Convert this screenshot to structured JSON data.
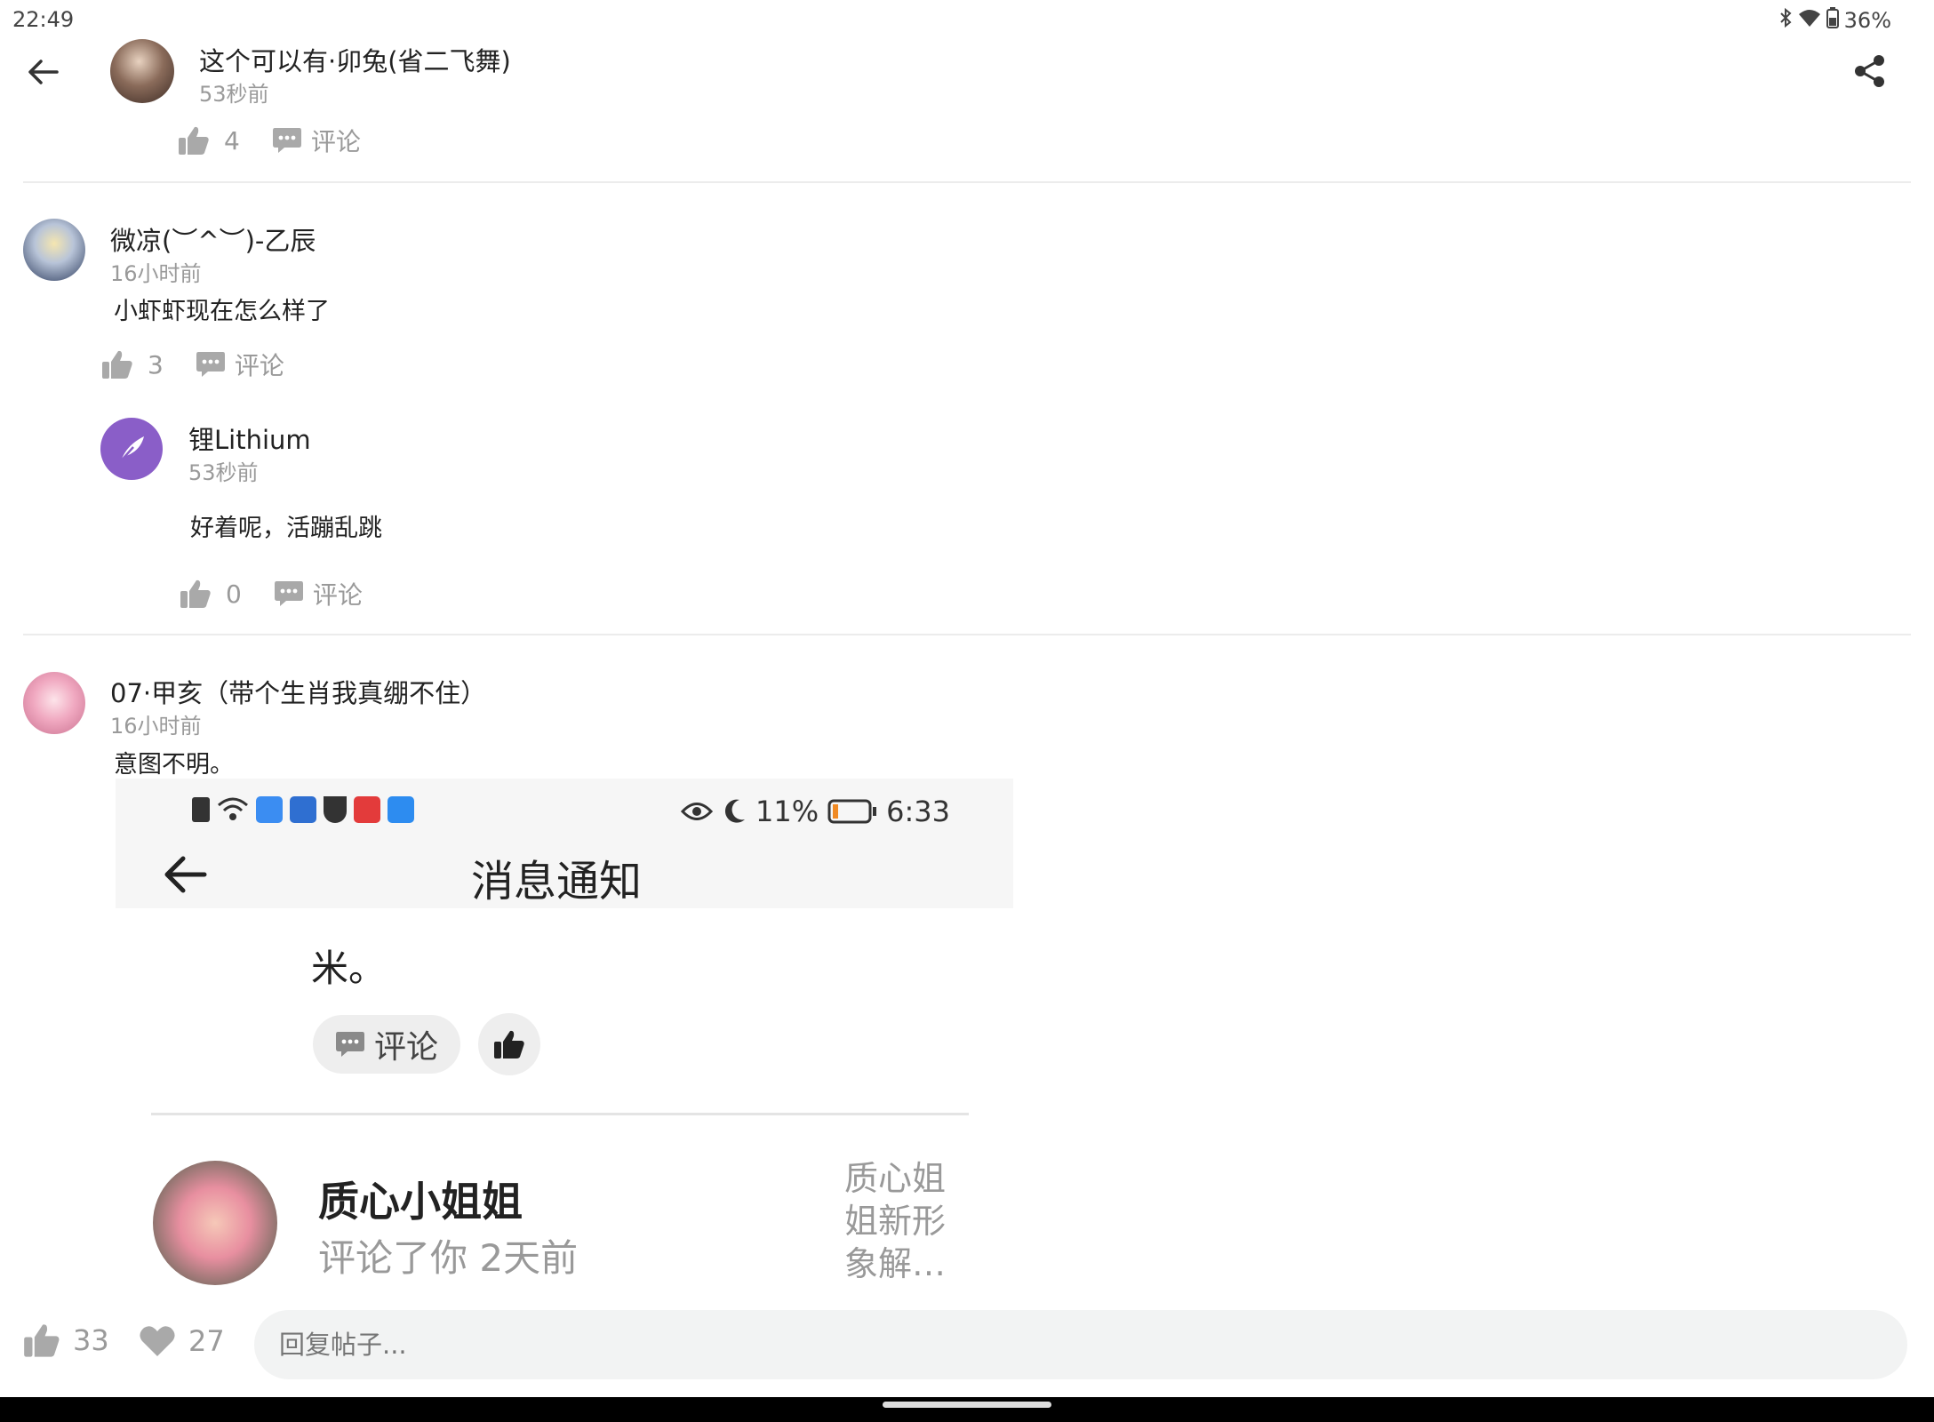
{
  "status": {
    "time": "22:49",
    "battery": "36%"
  },
  "header": {
    "author": "这个可以有·卯兔(省二飞舞)",
    "time": "53秒前",
    "likes": "4",
    "comment_label": "评论"
  },
  "comments": [
    {
      "author": "微凉(︶^︶)-乙辰",
      "time": "16小时前",
      "text": "小虾虾现在怎么样了",
      "likes": "3",
      "comment_label": "评论",
      "replies": [
        {
          "author": "锂Lithium",
          "time": "53秒前",
          "text": "好着呢，活蹦乱跳",
          "likes": "0",
          "comment_label": "评论"
        }
      ]
    },
    {
      "author": "07·甲亥（带个生肖我真绷不住）",
      "time": "16小时前",
      "text": "意图不明。",
      "screenshot": {
        "status_percent": "11%",
        "status_time": "6:33",
        "title": "消息通知",
        "trailing_text": "米。",
        "comment_button": "评论",
        "notifier_name": "质心小姐姐",
        "notifier_action": "评论了你 2天前",
        "preview_text": "质心姐姐新形象解…"
      }
    }
  ],
  "bottom": {
    "likes": "33",
    "favorites": "27",
    "reply_placeholder": "回复帖子..."
  }
}
